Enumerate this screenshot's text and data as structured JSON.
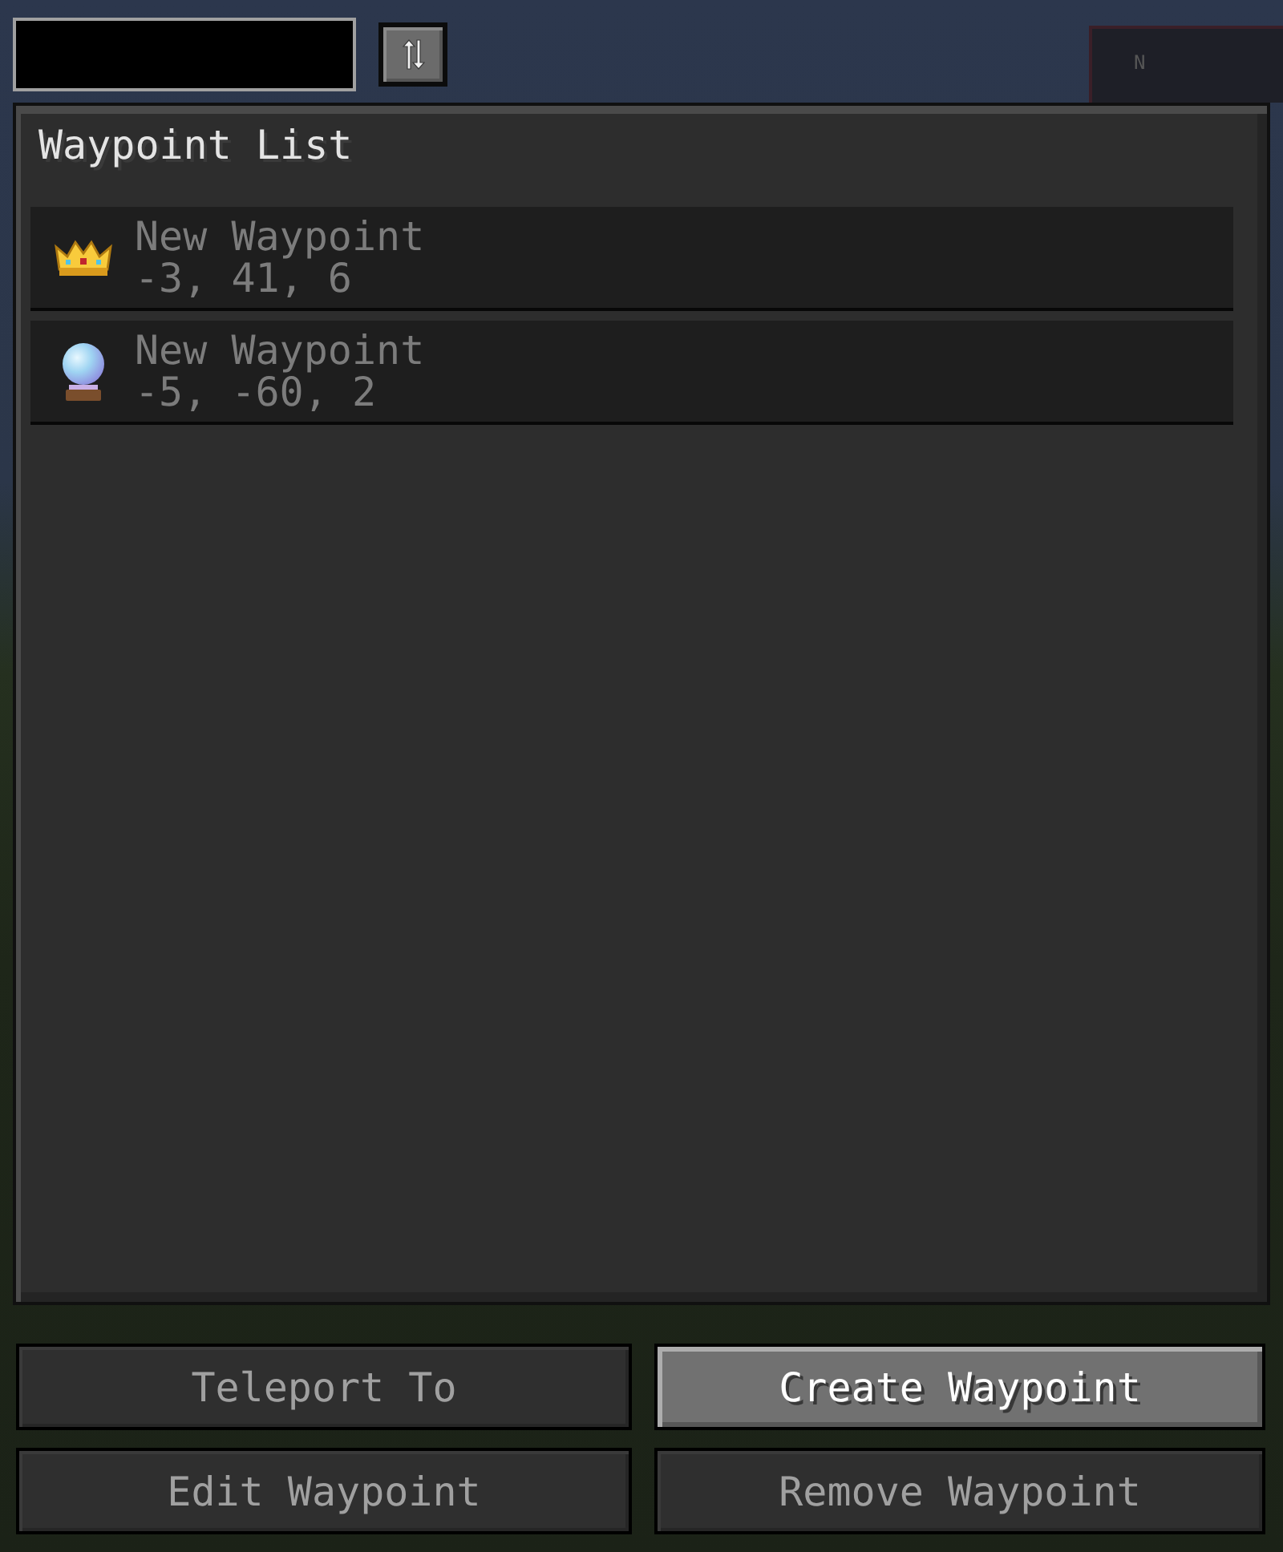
{
  "compass": {
    "heading": "N"
  },
  "panel": {
    "title": "Waypoint List"
  },
  "waypoints": [
    {
      "kind": "crown",
      "name": "New Waypoint",
      "coords": "-3, 41, 6",
      "selected": false
    },
    {
      "kind": "orb",
      "name": "New Waypoint",
      "coords": "-5, -60, 2",
      "selected": false
    }
  ],
  "buttons": [
    {
      "label": "Teleport To",
      "disabled": true
    },
    {
      "label": "Create Waypoint",
      "disabled": false
    },
    {
      "label": "Edit Waypoint",
      "disabled": true
    },
    {
      "label": "Remove Waypoint",
      "disabled": true
    }
  ]
}
